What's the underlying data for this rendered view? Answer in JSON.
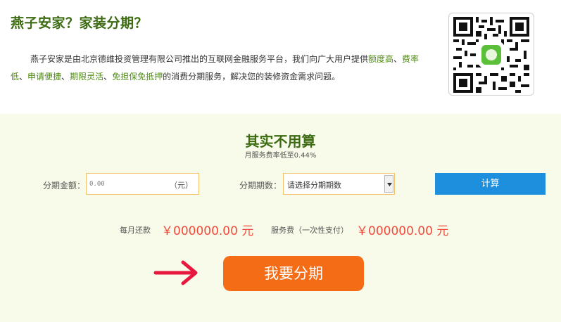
{
  "intro": {
    "title": "燕子安家？家装分期？",
    "text_1": "燕子安家是由北京德维投资管理有限公司推出的互联网金融服务平台，我们向广大用户提供",
    "hl_1": "额度高",
    "sep_1": "、",
    "hl_2": "费率低",
    "sep_2": "、",
    "hl_3": "申请便捷",
    "sep_3": "、",
    "hl_4": "期限灵活",
    "sep_4": "、",
    "hl_5": "免担保免抵押",
    "text_2": "的消费分期服务，解决您的装修资金需求问题。"
  },
  "calculator": {
    "title": "其实不用算",
    "subtitle": "月服务费率低至0.44%",
    "amount_label": "分期金额：",
    "amount_placeholder": "0.00",
    "amount_unit": "（元）",
    "period_label": "分期期数：",
    "period_selected": "请选择分期期数",
    "calc_button": "计算",
    "monthly_label": "每月还款",
    "monthly_value": "￥000000.00 元",
    "fee_label": "服务费（一次性支付）",
    "fee_value": "￥000000.00 元",
    "apply_button": "我要分期"
  },
  "colors": {
    "title_green": "#3d6b12",
    "calc_bg": "#f8fbe9",
    "input_border": "#f2c36a",
    "calc_button": "#1d8fdc",
    "apply_button": "#f46c16",
    "result_red": "#f3493b",
    "arrow_red": "#e8173f"
  },
  "icons": {
    "qr": "qr-code-icon",
    "dropdown": "chevron-down-icon",
    "arrow": "right-arrow-icon"
  }
}
